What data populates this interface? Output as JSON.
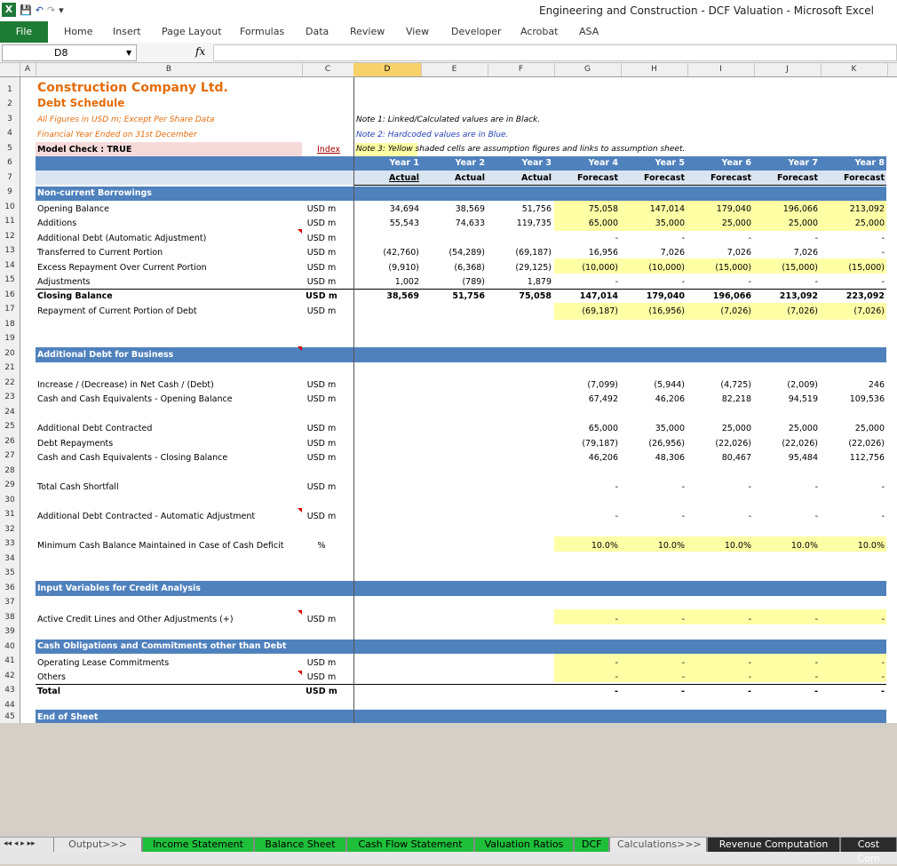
{
  "window": {
    "title": "Engineering and Construction - DCF Valuation  -  Microsoft Excel"
  },
  "ribbon": {
    "file": "File",
    "tabs": [
      "Home",
      "Insert",
      "Page Layout",
      "Formulas",
      "Data",
      "Review",
      "View",
      "Developer",
      "Acrobat",
      "ASA"
    ]
  },
  "formula_bar": {
    "name_box": "D8",
    "fx": "fx",
    "value": ""
  },
  "columns": [
    "A",
    "B",
    "C",
    "D",
    "E",
    "F",
    "G",
    "H",
    "I",
    "J",
    "K"
  ],
  "rows": [
    "1",
    "2",
    "3",
    "4",
    "5",
    "6",
    "7",
    "9",
    "10",
    "11",
    "12",
    "13",
    "14",
    "15",
    "16",
    "17",
    "18",
    "19",
    "20",
    "21",
    "22",
    "23",
    "24",
    "25",
    "26",
    "27",
    "28",
    "29",
    "30",
    "31",
    "32",
    "33",
    "34",
    "35",
    "36",
    "37",
    "38",
    "39",
    "40",
    "41",
    "42",
    "43",
    "44",
    "45"
  ],
  "header": {
    "company": "Construction Company Ltd.",
    "schedule": "Debt Schedule",
    "figures": "All Figures in USD m; Except Per Share Data",
    "fy": "Financial Year Ended on 31st December",
    "model_check": "Model Check : TRUE",
    "index": "Index",
    "note1": "Note 1: Linked/Calculated values are in Black.",
    "note2": "Note 2: Hardcoded values are in Blue.",
    "note3": "Note 3: Yellow shaded cells are assumption figures and links to assumption sheet."
  },
  "years": [
    "Year 1",
    "Year 2",
    "Year 3",
    "Year 4",
    "Year 5",
    "Year 6",
    "Year 7",
    "Year 8"
  ],
  "periods": [
    "Actual",
    "Actual",
    "Actual",
    "Forecast",
    "Forecast",
    "Forecast",
    "Forecast",
    "Forecast"
  ],
  "sections": {
    "ncb": "Non-current Borrowings",
    "additional": "Additional Debt for Business",
    "input": "Input Variables for Credit Analysis",
    "cash_obl": "Cash Obligations and Commitments other than Debt",
    "end": "End of Sheet"
  },
  "lines": {
    "r10": {
      "label": "Opening Balance",
      "unit": "USD m",
      "v": [
        "34,694",
        "38,569",
        "51,756",
        "75,058",
        "147,014",
        "179,040",
        "196,066",
        "213,092"
      ]
    },
    "r11": {
      "label": "Additions",
      "unit": "USD m",
      "v": [
        "55,543",
        "74,633",
        "119,735",
        "65,000",
        "35,000",
        "25,000",
        "25,000",
        "25,000"
      ]
    },
    "r12": {
      "label": "Additional Debt (Automatic Adjustment)",
      "unit": "USD m",
      "v": [
        "",
        "",
        "",
        "-",
        "-",
        "-",
        "-",
        "-"
      ]
    },
    "r13": {
      "label": "Transferred to Current Portion",
      "unit": "USD m",
      "v": [
        "(42,760)",
        "(54,289)",
        "(69,187)",
        "16,956",
        "7,026",
        "7,026",
        "7,026",
        "-"
      ]
    },
    "r14": {
      "label": "Excess Repayment Over Current Portion",
      "unit": "USD m",
      "v": [
        "(9,910)",
        "(6,368)",
        "(29,125)",
        "(10,000)",
        "(10,000)",
        "(15,000)",
        "(15,000)",
        "(15,000)"
      ]
    },
    "r15": {
      "label": "Adjustments",
      "unit": "USD m",
      "v": [
        "1,002",
        "(789)",
        "1,879",
        "-",
        "-",
        "-",
        "-",
        "-"
      ]
    },
    "r16": {
      "label": "Closing Balance",
      "unit": "USD m",
      "v": [
        "38,569",
        "51,756",
        "75,058",
        "147,014",
        "179,040",
        "196,066",
        "213,092",
        "223,092"
      ]
    },
    "r17": {
      "label": "Repayment of Current Portion of Debt",
      "unit": "USD m",
      "v": [
        "",
        "",
        "",
        "(69,187)",
        "(16,956)",
        "(7,026)",
        "(7,026)",
        "(7,026)"
      ]
    },
    "r22": {
      "label": "Increase / (Decrease) in Net Cash / (Debt)",
      "unit": "USD m",
      "v": [
        "",
        "",
        "",
        "(7,099)",
        "(5,944)",
        "(4,725)",
        "(2,009)",
        "246"
      ]
    },
    "r23": {
      "label": "Cash and Cash Equivalents - Opening Balance",
      "unit": "USD m",
      "v": [
        "",
        "",
        "",
        "67,492",
        "46,206",
        "82,218",
        "94,519",
        "109,536"
      ]
    },
    "r25": {
      "label": "Additional Debt Contracted",
      "unit": "USD m",
      "v": [
        "",
        "",
        "",
        "65,000",
        "35,000",
        "25,000",
        "25,000",
        "25,000"
      ]
    },
    "r26": {
      "label": "Debt Repayments",
      "unit": "USD m",
      "v": [
        "",
        "",
        "",
        "(79,187)",
        "(26,956)",
        "(22,026)",
        "(22,026)",
        "(22,026)"
      ]
    },
    "r27": {
      "label": "Cash and Cash Equivalents - Closing Balance",
      "unit": "USD m",
      "v": [
        "",
        "",
        "",
        "46,206",
        "48,306",
        "80,467",
        "95,484",
        "112,756"
      ]
    },
    "r29": {
      "label": "Total Cash Shortfall",
      "unit": "USD m",
      "v": [
        "",
        "",
        "",
        "-",
        "-",
        "-",
        "-",
        "-"
      ]
    },
    "r31": {
      "label": "Additional Debt Contracted - Automatic Adjustment",
      "unit": "USD m",
      "v": [
        "",
        "",
        "",
        "-",
        "-",
        "-",
        "-",
        "-"
      ]
    },
    "r33": {
      "label": "Minimum Cash Balance Maintained in Case of Cash Deficit",
      "unit": "%",
      "v": [
        "",
        "",
        "",
        "10.0%",
        "10.0%",
        "10.0%",
        "10.0%",
        "10.0%"
      ]
    },
    "r38": {
      "label": "Active Credit Lines and Other Adjustments (+)",
      "unit": "USD m",
      "v": [
        "",
        "",
        "",
        "-",
        "-",
        "-",
        "-",
        "-"
      ]
    },
    "r41": {
      "label": "Operating Lease Commitments",
      "unit": "USD m",
      "v": [
        "",
        "",
        "",
        "-",
        "-",
        "-",
        "-",
        "-"
      ]
    },
    "r42": {
      "label": "Others",
      "unit": "USD m",
      "v": [
        "",
        "",
        "",
        "-",
        "-",
        "-",
        "-",
        "-"
      ]
    },
    "r43": {
      "label": "Total",
      "unit": "USD m",
      "v": [
        "",
        "",
        "",
        "-",
        "-",
        "-",
        "-",
        "-"
      ]
    }
  },
  "sheet_tabs": [
    {
      "label": "Output>>>",
      "color": "#e8e8e8",
      "fg": "#555555"
    },
    {
      "label": "Income Statement",
      "color": "#1fbf3a",
      "fg": "#000000"
    },
    {
      "label": "Balance Sheet",
      "color": "#1fbf3a",
      "fg": "#000000"
    },
    {
      "label": "Cash Flow Statement",
      "color": "#1fbf3a",
      "fg": "#000000"
    },
    {
      "label": "Valuation Ratios",
      "color": "#1fbf3a",
      "fg": "#000000"
    },
    {
      "label": "DCF",
      "color": "#1fbf3a",
      "fg": "#000000"
    },
    {
      "label": "Calculations>>>",
      "color": "#e8e8e8",
      "fg": "#555555"
    },
    {
      "label": "Revenue Computation",
      "color": "#2b2b2b",
      "fg": "#ffffff"
    },
    {
      "label": "Cost Com",
      "color": "#2b2b2b",
      "fg": "#ffffff"
    }
  ],
  "sheet_nav": "◂◂ ◂ ▸ ▸▸"
}
